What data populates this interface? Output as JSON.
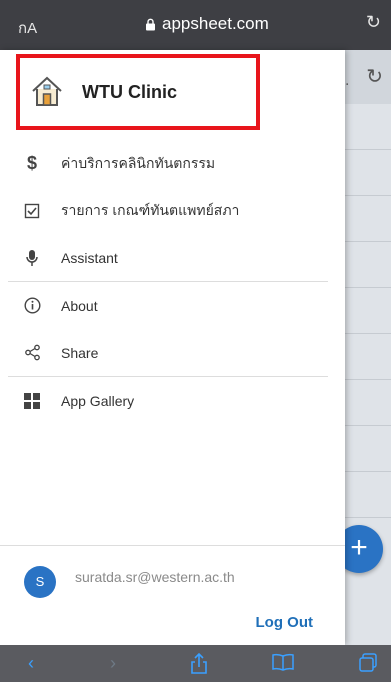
{
  "browser": {
    "reader_label": "กA",
    "url": "appsheet.com",
    "reload_glyph": "↻"
  },
  "app": {
    "title": "WTU Clinic",
    "menu": [
      {
        "label": "ค่าบริการคลินิกทันตกรรม",
        "icon": "dollar-icon"
      },
      {
        "label": "รายการ เกณฑ์ทันตแพทย์สภา",
        "icon": "checkbox-icon"
      },
      {
        "label": "Assistant",
        "icon": "microphone-icon"
      },
      {
        "label": "About",
        "icon": "info-icon"
      },
      {
        "label": "Share",
        "icon": "share-icon"
      },
      {
        "label": "App Gallery",
        "icon": "app-gallery-icon"
      }
    ],
    "user": {
      "initial": "S",
      "email": "suratda.sr@western.ac.th"
    },
    "logout_label": "Log Out",
    "fab_label": "+"
  },
  "colors": {
    "accent": "#2a73c4",
    "highlight_border": "#e8151b",
    "logout": "#1f6fb8"
  }
}
